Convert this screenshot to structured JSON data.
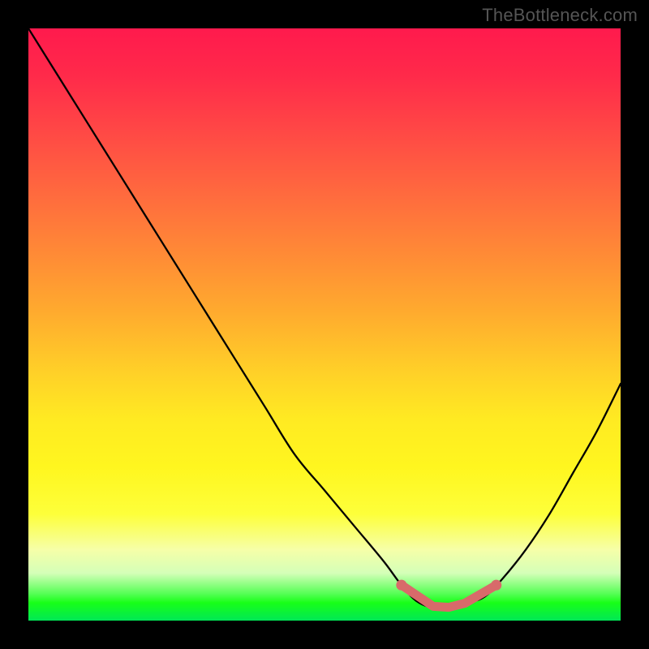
{
  "watermark": "TheBottleneck.com",
  "colors": {
    "frame_bg": "#000000",
    "curve": "#000000",
    "marker": "#d86a6a",
    "gradient_top": "#ff1a4d",
    "gradient_bottom": "#00e756"
  },
  "chart_data": {
    "type": "line",
    "title": "",
    "xlabel": "",
    "ylabel": "",
    "xlim": [
      0,
      100
    ],
    "ylim": [
      0,
      100
    ],
    "grid": false,
    "legend": false,
    "note": "Background is a vertical red→green gradient. The black curve is a V-shaped bottleneck curve with its minimum near x≈70. The pink segment marks the low-bottleneck region (≈x 63–79).",
    "series": [
      {
        "name": "bottleneck_curve",
        "x": [
          0,
          5,
          10,
          15,
          20,
          25,
          30,
          35,
          40,
          45,
          50,
          55,
          60,
          63,
          66,
          70,
          74,
          77,
          80,
          84,
          88,
          92,
          96,
          100
        ],
        "y": [
          100,
          92,
          84,
          76,
          68,
          60,
          52,
          44,
          36,
          28,
          22,
          16,
          10,
          6,
          3,
          2,
          3,
          4,
          7,
          12,
          18,
          25,
          32,
          40
        ]
      }
    ],
    "highlight_range": {
      "x_start": 63,
      "x_end": 79,
      "y": 3
    }
  }
}
